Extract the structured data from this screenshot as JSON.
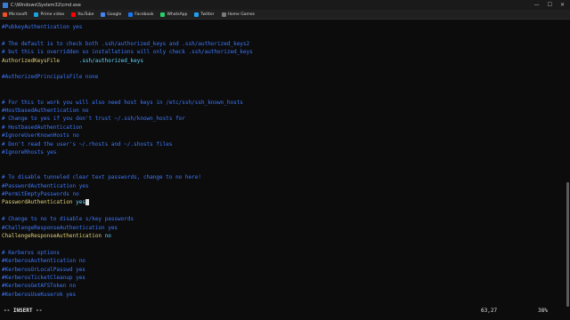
{
  "window": {
    "title": "C:\\Windows\\System32\\cmd.exe",
    "controls": [
      "—",
      "☐",
      "✕"
    ]
  },
  "bookmarks": [
    {
      "label": "Microsoft",
      "color": "#f25022"
    },
    {
      "label": "Prime video",
      "color": "#1ba1e2"
    },
    {
      "label": "YouTube",
      "color": "#ff0000"
    },
    {
      "label": "Google",
      "color": "#4285f4"
    },
    {
      "label": "Facebook",
      "color": "#1877f2"
    },
    {
      "label": "WhatsApp",
      "color": "#25d366"
    },
    {
      "label": "Twitter",
      "color": "#1da1f2"
    },
    {
      "label": "Home Games",
      "color": "#7a7a7a"
    }
  ],
  "editor": {
    "lines": [
      {
        "text": "#PubkeyAuthentication yes",
        "style": "comment"
      },
      {
        "text": "",
        "style": "plain"
      },
      {
        "text": "# The default is to check both .ssh/authorized_keys and .ssh/authorized_keys2",
        "style": "comment"
      },
      {
        "text": "# but this is overridden so installations will only check .ssh/authorized_keys",
        "style": "comment"
      },
      {
        "key": "AuthorizedKeysFile",
        "value": "      .ssh/authorized_keys",
        "style": "kv"
      },
      {
        "text": "",
        "style": "plain"
      },
      {
        "text": "#AuthorizedPrincipalsFile none",
        "style": "comment"
      },
      {
        "text": "",
        "style": "plain"
      },
      {
        "text": "",
        "style": "plain"
      },
      {
        "text": "# For this to work you will also need host keys in /etc/ssh/ssh_known_hosts",
        "style": "comment"
      },
      {
        "text": "#HostbasedAuthentication no",
        "style": "comment"
      },
      {
        "text": "# Change to yes if you don't trust ~/.ssh/known_hosts for",
        "style": "comment"
      },
      {
        "text": "# HostbasedAuthentication",
        "style": "comment"
      },
      {
        "text": "#IgnoreUserKnownHosts no",
        "style": "comment"
      },
      {
        "text": "# Don't read the user's ~/.rhosts and ~/.shosts files",
        "style": "comment"
      },
      {
        "text": "#IgnoreRhosts yes",
        "style": "comment"
      },
      {
        "text": "",
        "style": "plain"
      },
      {
        "text": "",
        "style": "plain"
      },
      {
        "text": "# To disable tunneled clear text passwords, change to no here!",
        "style": "comment"
      },
      {
        "text": "#PasswordAuthentication yes",
        "style": "comment"
      },
      {
        "text": "#PermitEmptyPasswords no",
        "style": "comment"
      },
      {
        "key": "PasswordAuthentication",
        "value": " yes",
        "style": "kv",
        "cursor": true
      },
      {
        "text": "",
        "style": "plain"
      },
      {
        "text": "# Change to no to disable s/key passwords",
        "style": "comment"
      },
      {
        "text": "#ChallengeResponseAuthentication yes",
        "style": "comment"
      },
      {
        "key": "ChallengeResponseAuthentication",
        "value": " no",
        "style": "kv"
      },
      {
        "text": "",
        "style": "plain"
      },
      {
        "text": "# Kerberos options",
        "style": "comment"
      },
      {
        "text": "#KerberosAuthentication no",
        "style": "comment"
      },
      {
        "text": "#KerberosOrLocalPasswd yes",
        "style": "comment"
      },
      {
        "text": "#KerberosTicketCleanup yes",
        "style": "comment"
      },
      {
        "text": "#KerberosGetAFSToken no",
        "style": "comment"
      },
      {
        "text": "#KerberosUseKuserok yes",
        "style": "comment"
      }
    ]
  },
  "status": {
    "mode": "-- INSERT --",
    "position": "63,27",
    "percent": "38%"
  }
}
